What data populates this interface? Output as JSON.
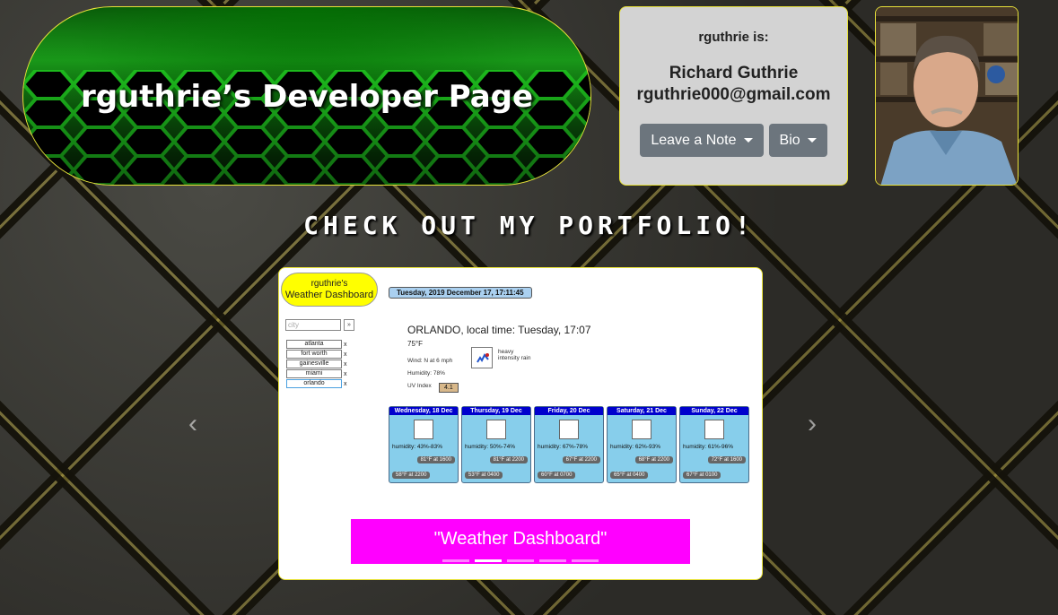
{
  "header": {
    "title": "rguthrie’s Developer Page"
  },
  "info": {
    "label": "rguthrie is:",
    "name": "Richard Guthrie",
    "email": "rguthrie000@gmail.com",
    "buttons": {
      "note": "Leave a Note",
      "bio": "Bio"
    }
  },
  "section": {
    "heading": "CHECK OUT MY PORTFOLIO!"
  },
  "carousel": {
    "prev_icon": "chevron-left-icon",
    "next_icon": "chevron-right-icon",
    "caption": "\"Weather Dashboard\"",
    "active_index": 1,
    "slide_count": 5,
    "screenshot": {
      "logo_line1": "rguthrie's",
      "logo_line2": "Weather Dashboard",
      "date": "Tuesday, 2019 December 17, 17:11:45",
      "search_placeholder": "city",
      "search_button": "»",
      "cities": [
        "atlanta",
        "fort worth",
        "gainesville",
        "miami",
        "orlando"
      ],
      "remove_label": "x",
      "headline": "ORLANDO, local time: Tuesday, 17:07",
      "temp": "75°F",
      "wind": "Wind: N at 6 mph",
      "humidity": "Humidity: 78%",
      "uv_label": "UV Index",
      "uv_value": "4.1",
      "condition": "heavy intensity rain",
      "forecast": [
        {
          "day": "Wednesday, 18 Dec",
          "humidity": "humidity: 43%-83%",
          "hi": "81°F at 1600",
          "lo": "58°F at 2200"
        },
        {
          "day": "Thursday, 19 Dec",
          "humidity": "humidity: 50%-74%",
          "hi": "81°F at 2200",
          "lo": "53°F at 0400"
        },
        {
          "day": "Friday, 20 Dec",
          "humidity": "humidity: 67%-78%",
          "hi": "67°F at 2200",
          "lo": "60°F at 0700"
        },
        {
          "day": "Saturday, 21 Dec",
          "humidity": "humidity: 62%-93%",
          "hi": "68°F at 2200",
          "lo": "65°F at 0400"
        },
        {
          "day": "Sunday, 22 Dec",
          "humidity": "humidity: 61%-96%",
          "hi": "72°F at 1600",
          "lo": "67°F at 0100"
        }
      ]
    }
  },
  "colors": {
    "accent_border": "#e8e23a",
    "button_bg": "#6c757d",
    "caption_bg": "#ff00ff",
    "card_bg": "#d3d3d3",
    "banner_green": "#1db11d"
  }
}
